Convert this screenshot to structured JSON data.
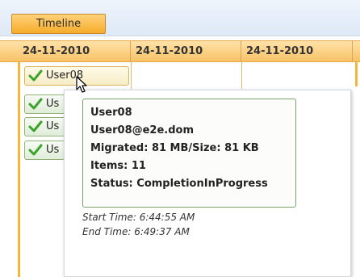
{
  "toolbar": {
    "timeline_label": "Timeline"
  },
  "header": {
    "dates": [
      "24-11-2010",
      "24-11-2010",
      "24-11-2010"
    ]
  },
  "items": [
    {
      "label": "User08",
      "state": "hover"
    },
    {
      "label": "Us"
    },
    {
      "label": "Us"
    },
    {
      "label": "Us"
    }
  ],
  "tooltip": {
    "user": "User08",
    "email": "User08@e2e.dom",
    "migrated": "Migrated: 81 MB/Size: 81 KB",
    "items": "Items: 11",
    "status": "Status: CompletionInProgress",
    "start_time": "Start Time: 6:44:55 AM",
    "end_time": "End Time: 6:49:37 AM"
  },
  "colors": {
    "accent": "#f6ac2a",
    "header_bg": "#f7c266",
    "success": "#3aa32a",
    "tooltip_border": "#7aa26a"
  },
  "icons": [
    "check-icon",
    "mouse-cursor-icon"
  ]
}
